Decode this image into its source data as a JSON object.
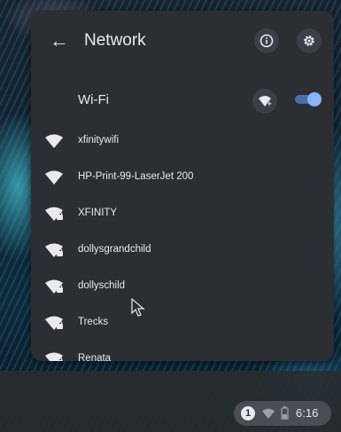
{
  "header": {
    "back_icon": "arrow-left-icon",
    "title": "Network",
    "info_icon": "info-icon",
    "settings_icon": "gear-icon"
  },
  "wifi": {
    "label": "Wi-Fi",
    "add_network_icon": "add-wifi-icon",
    "enabled": true,
    "toggle_color": "#8ab4f8"
  },
  "networks": [
    {
      "name": "xfinitywifi",
      "secured": false
    },
    {
      "name": "HP-Print-99-LaserJet 200",
      "secured": false
    },
    {
      "name": "XFINITY",
      "secured": true
    },
    {
      "name": "dollysgrandchild",
      "secured": true
    },
    {
      "name": "dollyschild",
      "secured": true
    },
    {
      "name": "Trecks",
      "secured": true
    },
    {
      "name": "Renata",
      "secured": true
    }
  ],
  "tray": {
    "notification_count": "1",
    "time": "6:16"
  },
  "colors": {
    "panel_bg": "#2b2e33",
    "text": "#e8eaed",
    "accent": "#8ab4f8"
  }
}
